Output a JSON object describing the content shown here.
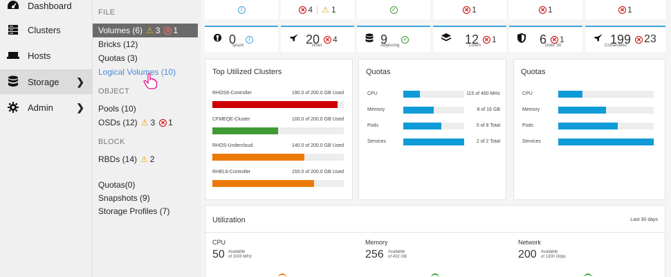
{
  "nav": {
    "items": [
      {
        "label": "Dashboard",
        "icon": "dashboard-icon"
      },
      {
        "label": "Clusters",
        "icon": "server-icon"
      },
      {
        "label": "Hosts",
        "icon": "host-icon"
      },
      {
        "label": "Storage",
        "icon": "database-icon"
      },
      {
        "label": "Admin",
        "icon": "gear-icon"
      }
    ]
  },
  "submenu": {
    "file_head": "FILE",
    "volumes": {
      "label": "Volumes (6)",
      "warn": "3",
      "err": "1"
    },
    "bricks": "Bricks (12)",
    "quotas": "Quotas (3)",
    "logical_volumes": "Logical Volumes (10)",
    "object_head": "OBJECT",
    "pools": "Pools (10)",
    "osds": {
      "label": "OSDs (12)",
      "warn": "3",
      "err": "1"
    },
    "block_head": "BLOCK",
    "rbds": {
      "label": "RBDs (14)",
      "warn": "2"
    },
    "quotas0": "Quotas(0)",
    "snapshots": "Snapshots (9)",
    "storage_profiles": "Storage Profiles (7)"
  },
  "top_row": {
    "c2_err": "4",
    "c2_warn": "1",
    "c4_err": "1",
    "c5_err": "1",
    "c6_err": "1"
  },
  "status_cards": [
    {
      "count": "0",
      "label": "Ipsum"
    },
    {
      "count": "20",
      "label": "Amet",
      "err": "4"
    },
    {
      "count": "9",
      "label": "Adipiscing"
    },
    {
      "count": "12",
      "label": "Lorem",
      "err": "1"
    },
    {
      "count": "6",
      "label": "Dolor Sit",
      "err": "1"
    },
    {
      "count": "199",
      "label": "Consectetur",
      "err": "23"
    }
  ],
  "utilized": {
    "title": "Top Utilized Clusters",
    "clusters": [
      {
        "name": "RHOS6-Controller",
        "used": "190.0 of 200.0 GB Used",
        "pct": 0.95,
        "color": "#cc0000"
      },
      {
        "name": "CFMEQE-Cluster",
        "used": "100.0 of 200.0 GB Used",
        "pct": 0.5,
        "color": "#3f9c35"
      },
      {
        "name": "RHOS-Undercloud",
        "used": "140.0 of 200.0 GB Used",
        "pct": 0.7,
        "color": "#ec7a08"
      },
      {
        "name": "RHEL6-Controller",
        "used": "155.0 of 200.0 GB Used",
        "pct": 0.775,
        "color": "#ec7a08"
      }
    ]
  },
  "quotas1": {
    "title": "Quotas",
    "rows": [
      {
        "name": "CPU",
        "pct": 0.27,
        "val": "115 of 460 MHz"
      },
      {
        "name": "Memory",
        "pct": 0.5,
        "val": "8 of 16 GB"
      },
      {
        "name": "Pods",
        "pct": 0.625,
        "val": "5 of 8 Total"
      },
      {
        "name": "Services",
        "pct": 1.0,
        "val": "2 of 2 Total"
      }
    ]
  },
  "quotas2": {
    "title": "Quotas",
    "rows": [
      {
        "name": "CPU",
        "pct": 0.25
      },
      {
        "name": "Memory",
        "pct": 0.5
      },
      {
        "name": "Pods",
        "pct": 0.625
      },
      {
        "name": "Services",
        "pct": 1.0
      }
    ]
  },
  "utilization": {
    "title": "Utilization",
    "range": "Last 30 days",
    "metrics": [
      {
        "name": "CPU",
        "num": "50",
        "avail": "Available",
        "of": "of 1000 MHz"
      },
      {
        "name": "Memory",
        "num": "256",
        "avail": "Available",
        "of": "of 432 GB"
      },
      {
        "name": "Network",
        "num": "200",
        "avail": "Available",
        "of": "of 1300 Gbps"
      }
    ]
  },
  "colors": {
    "accent": "#39a5dc",
    "error": "#cc0000",
    "warning": "#f0a000",
    "ok": "#3f9c35",
    "bar": "#0f9bd7"
  }
}
